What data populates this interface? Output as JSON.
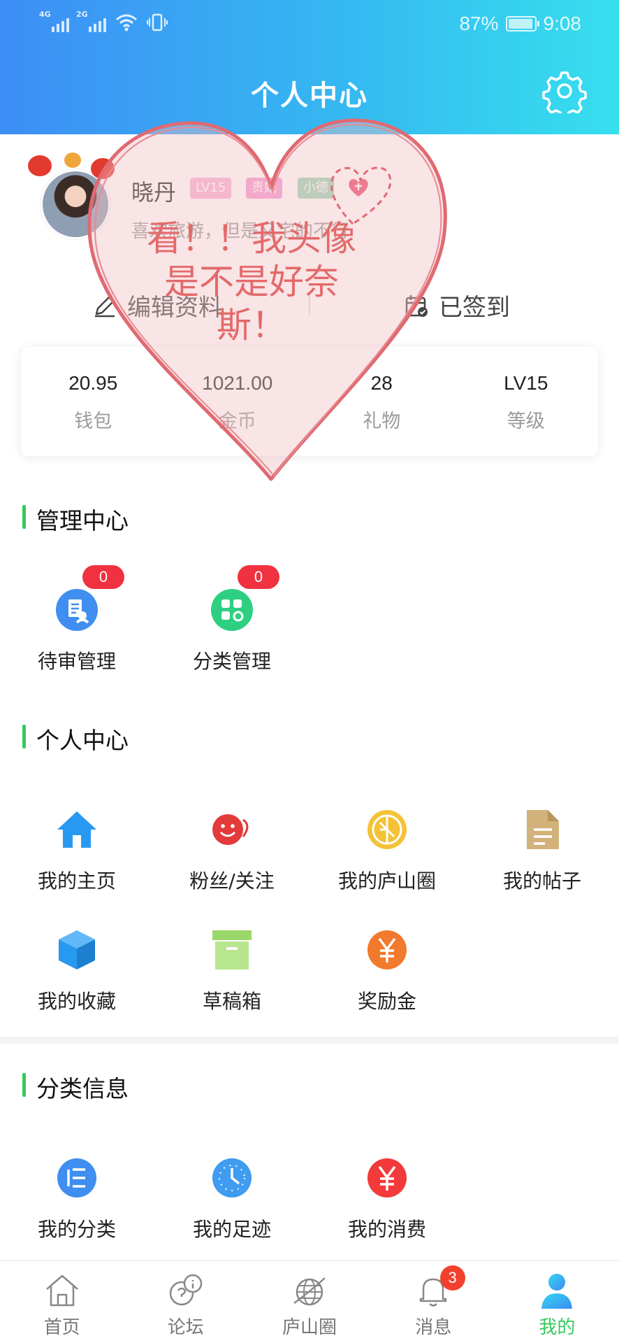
{
  "status_bar": {
    "signal_1": "4G",
    "signal_2": "2G",
    "battery": "87%",
    "time": "9:08"
  },
  "header": {
    "title": "个人中心",
    "settings_icon": "gear-icon"
  },
  "profile": {
    "nickname": "晓丹",
    "badges": [
      "LV15",
      "贵妃",
      "小德"
    ],
    "signature": "喜欢旅游，但是又宅的不行",
    "edit_label": "编辑资料",
    "signed_label": "已签到"
  },
  "stats": [
    {
      "value": "20.95",
      "label": "钱包"
    },
    {
      "value": "1021.00",
      "label": "金币"
    },
    {
      "value": "28",
      "label": "礼物"
    },
    {
      "value": "LV15",
      "label": "等级"
    }
  ],
  "admin": {
    "title": "管理中心",
    "items": [
      {
        "label": "待审管理",
        "count": "0",
        "icon": "review-icon"
      },
      {
        "label": "分类管理",
        "count": "0",
        "icon": "category-settings-icon"
      }
    ]
  },
  "personal": {
    "title": "个人中心",
    "items": [
      {
        "label": "我的主页",
        "icon": "home-icon"
      },
      {
        "label": "粉丝/关注",
        "icon": "fans-icon"
      },
      {
        "label": "我的庐山圈",
        "icon": "circle-icon"
      },
      {
        "label": "我的帖子",
        "icon": "document-icon"
      },
      {
        "label": "我的收藏",
        "icon": "box-icon"
      },
      {
        "label": "草稿箱",
        "icon": "archive-icon"
      },
      {
        "label": "奖励金",
        "icon": "yen-icon"
      }
    ]
  },
  "category": {
    "title": "分类信息",
    "items": [
      {
        "label": "我的分类",
        "icon": "list-icon"
      },
      {
        "label": "我的足迹",
        "icon": "clock-icon"
      },
      {
        "label": "我的消费",
        "icon": "yen-icon"
      }
    ]
  },
  "overlay": {
    "text": "看！！我头像是不是好奈斯！"
  },
  "bottom_nav": {
    "items": [
      {
        "label": "首页",
        "icon": "home-outline-icon"
      },
      {
        "label": "论坛",
        "icon": "forum-icon"
      },
      {
        "label": "庐山圈",
        "icon": "globe-icon"
      },
      {
        "label": "消息",
        "icon": "bell-icon",
        "badge": "3"
      },
      {
        "label": "我的",
        "icon": "user-icon"
      }
    ],
    "active": "我的"
  },
  "colors": {
    "header_start": "#3d8ef5",
    "header_end": "#37dfee",
    "accent_green": "#36c95b",
    "badge_red": "#f0313f",
    "overlay_heart": "#e36a6a"
  }
}
